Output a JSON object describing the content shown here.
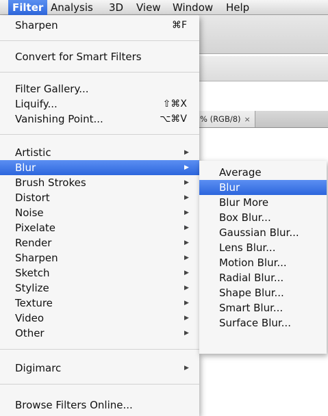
{
  "menubar": {
    "items": [
      {
        "label": "Filter"
      },
      {
        "label": "Analysis"
      },
      {
        "label": "3D"
      },
      {
        "label": "View"
      },
      {
        "label": "Window"
      },
      {
        "label": "Help"
      }
    ]
  },
  "background": {
    "tab_label": "% (RGB/8)",
    "tab_close": "×"
  },
  "filter_menu": {
    "last_filter": {
      "label": "Sharpen",
      "shortcut": "⌘F"
    },
    "convert_smart": {
      "label": "Convert for Smart Filters"
    },
    "filter_gallery": {
      "label": "Filter Gallery..."
    },
    "liquify": {
      "label": "Liquify...",
      "shortcut": "⇧⌘X"
    },
    "vanishing_point": {
      "label": "Vanishing Point...",
      "shortcut": "⌥⌘V"
    },
    "groups": [
      {
        "label": "Artistic"
      },
      {
        "label": "Blur"
      },
      {
        "label": "Brush Strokes"
      },
      {
        "label": "Distort"
      },
      {
        "label": "Noise"
      },
      {
        "label": "Pixelate"
      },
      {
        "label": "Render"
      },
      {
        "label": "Sharpen"
      },
      {
        "label": "Sketch"
      },
      {
        "label": "Stylize"
      },
      {
        "label": "Texture"
      },
      {
        "label": "Video"
      },
      {
        "label": "Other"
      }
    ],
    "digimarc": {
      "label": "Digimarc"
    },
    "browse_online": {
      "label": "Browse Filters Online..."
    },
    "submenu_arrow": "▶"
  },
  "blur_submenu": {
    "items": [
      {
        "label": "Average"
      },
      {
        "label": "Blur"
      },
      {
        "label": "Blur More"
      },
      {
        "label": "Box Blur..."
      },
      {
        "label": "Gaussian Blur..."
      },
      {
        "label": "Lens Blur..."
      },
      {
        "label": "Motion Blur..."
      },
      {
        "label": "Radial Blur..."
      },
      {
        "label": "Shape Blur..."
      },
      {
        "label": "Smart Blur..."
      },
      {
        "label": "Surface Blur..."
      }
    ]
  },
  "colors": {
    "highlight": "#3a74e4",
    "menu_bg": "#f6f6f6"
  }
}
